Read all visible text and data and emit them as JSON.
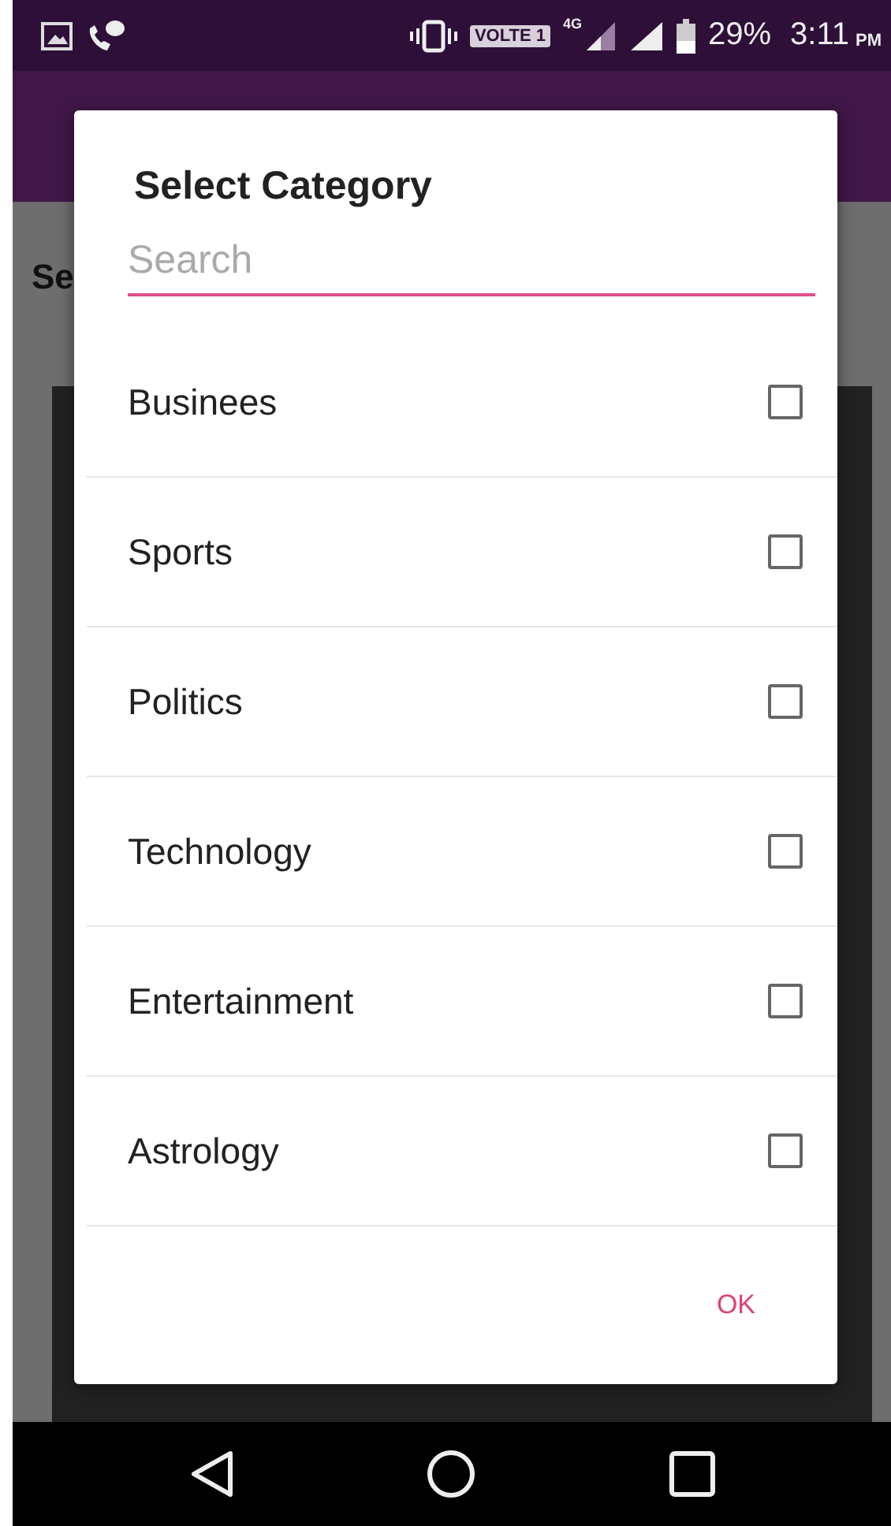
{
  "status_bar": {
    "volte": "VOLTE 1",
    "network": "4G",
    "battery": "29%",
    "time": "3:11",
    "ampm": "PM"
  },
  "background": {
    "heading": "Se"
  },
  "dialog": {
    "title": "Select Category",
    "search": {
      "placeholder": "Search"
    },
    "items": [
      {
        "label": "Businees",
        "checked": false
      },
      {
        "label": "Sports",
        "checked": false
      },
      {
        "label": "Politics",
        "checked": false
      },
      {
        "label": "Technology",
        "checked": false
      },
      {
        "label": "Entertainment",
        "checked": false
      },
      {
        "label": "Astrology",
        "checked": false
      }
    ],
    "buttons": [
      "OK"
    ]
  }
}
